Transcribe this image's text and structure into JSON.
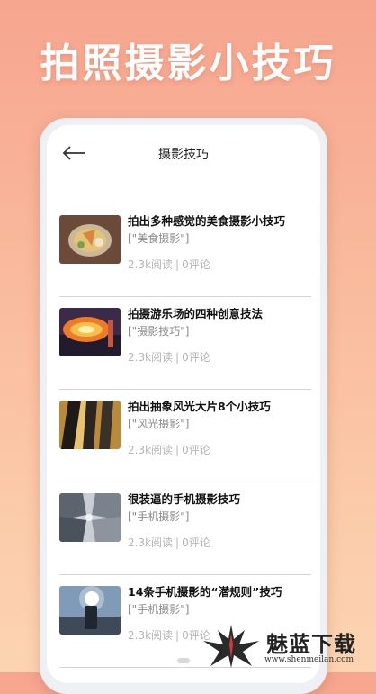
{
  "headline": "拍照摄影小技巧",
  "header": {
    "title": "摄影技巧",
    "back_icon": "arrow-left-icon"
  },
  "articles": [
    {
      "title": "拍出多种感觉的美食摄影小技巧",
      "tag": "[\"美食摄影\"]",
      "reads": "2.3k阅读",
      "comments": "0评论"
    },
    {
      "title": "拍摄游乐场的四种创意技法",
      "tag": "[\"摄影技巧\"]",
      "reads": "2.3k阅读",
      "comments": "0评论"
    },
    {
      "title": "拍出抽象风光大片8个小技巧",
      "tag": "[\"风光摄影\"]",
      "reads": "2.3k阅读",
      "comments": "0评论"
    },
    {
      "title": "很装逼的手机摄影技巧",
      "tag": "[\"手机摄影\"]",
      "reads": "2.3k阅读",
      "comments": "0评论"
    },
    {
      "title": "14条手机摄影的“潜规则”技巧",
      "tag": "[\"手机摄影\"]",
      "reads": "2.3k阅读",
      "comments": "0评论"
    }
  ],
  "meta_separator": "|",
  "watermark": {
    "name": "魅蓝下载",
    "url": "www.shenmeilan.com"
  },
  "colors": {
    "background_top": "#f7a58e",
    "background_bottom": "#fcd4b2",
    "headline": "#ffffff"
  }
}
